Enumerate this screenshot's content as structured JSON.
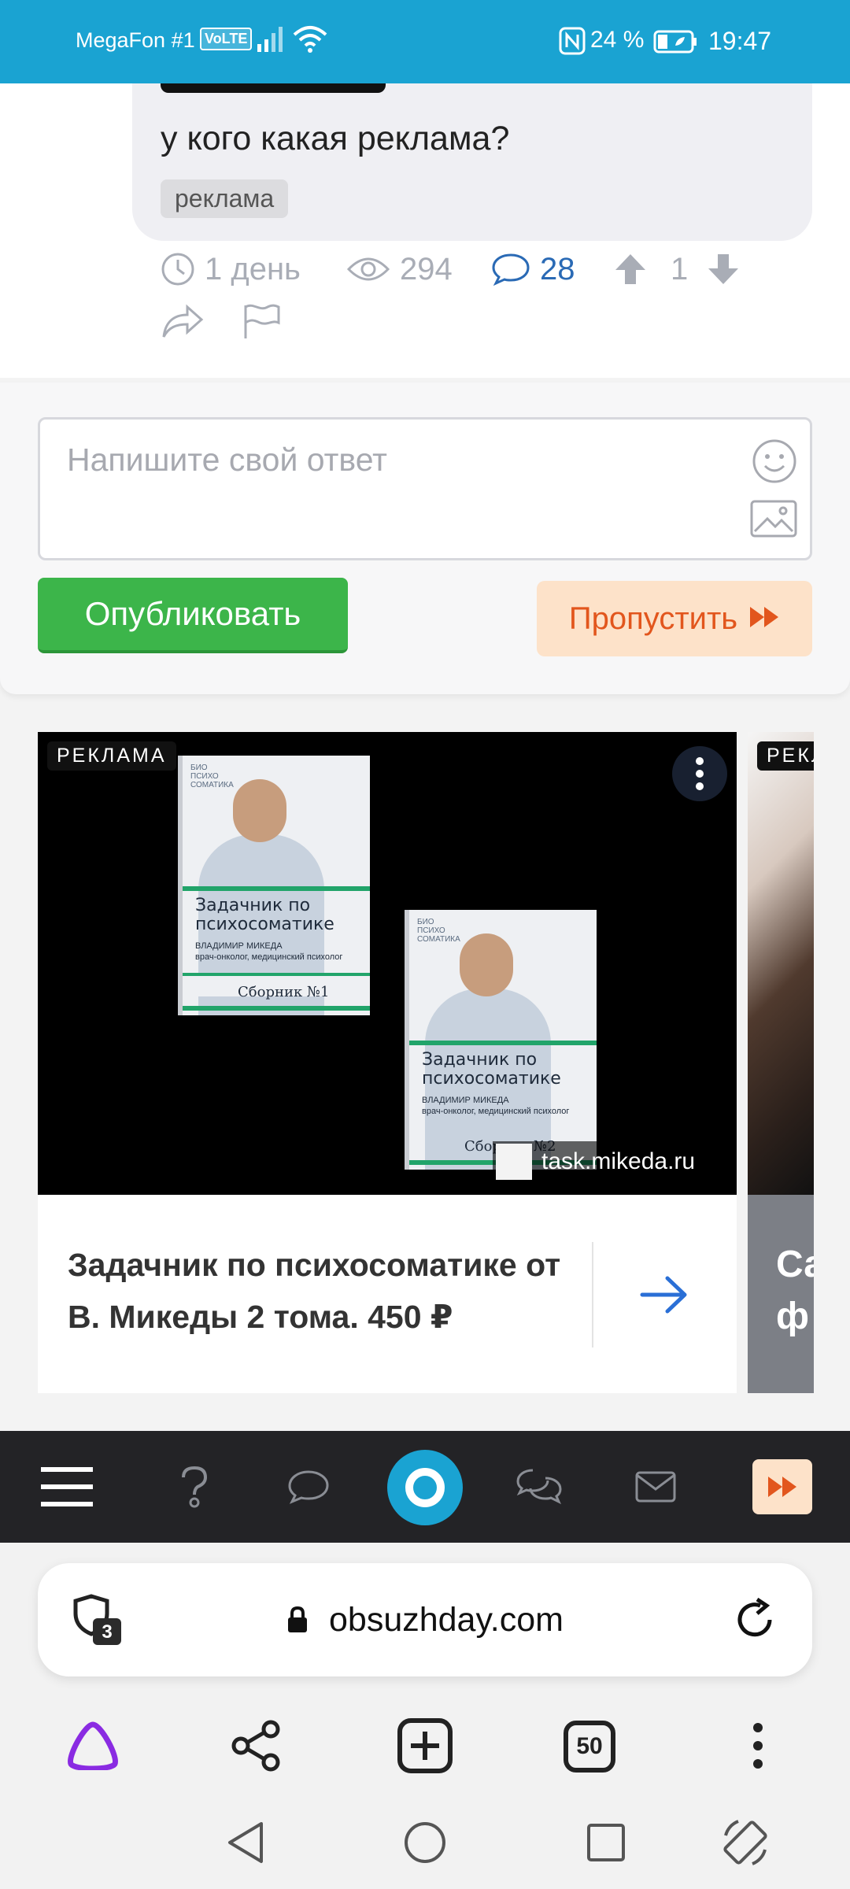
{
  "status_bar": {
    "carrier": "MegaFon #1",
    "volte": "VoLTE",
    "battery_percent": "24 %",
    "time": "19:47"
  },
  "post": {
    "question": "у кого какая реклама?",
    "tag": "реклама",
    "age": "1 день",
    "views": "294",
    "comments": "28",
    "votes": "1"
  },
  "reply": {
    "placeholder": "Напишите свой ответ",
    "publish_label": "Опубликовать",
    "skip_label": "Пропустить"
  },
  "ad": {
    "label": "РЕКЛАМА",
    "book_title_line1": "Задачник по",
    "book_title_line2": "психосоматике",
    "book_author": "ВЛАДИМИР МИКЕДА",
    "book_author_sub": "врач-онколог, медицинский психолог",
    "book_series_1": "Сборник №1",
    "book_series_2": "Сборник №2",
    "book_logo": "БИО ПСИХО СОМАТИКА",
    "domain": "task.mikeda.ru",
    "text": "Задачник по психосоматике от В. Микеды 2 тома. 450 ₽",
    "next_label": "РЕКЛ",
    "next_text": "Са ф"
  },
  "browser": {
    "shield_count": "3",
    "url": "obsuzhday.com",
    "tabs_count": "50"
  },
  "colors": {
    "status_bar": "#1aa3d2",
    "publish": "#3cb54a",
    "skip_bg": "#fde2c9",
    "skip_fg": "#e2561d",
    "comments": "#2a6ab5",
    "alice": "#8a2be2"
  }
}
